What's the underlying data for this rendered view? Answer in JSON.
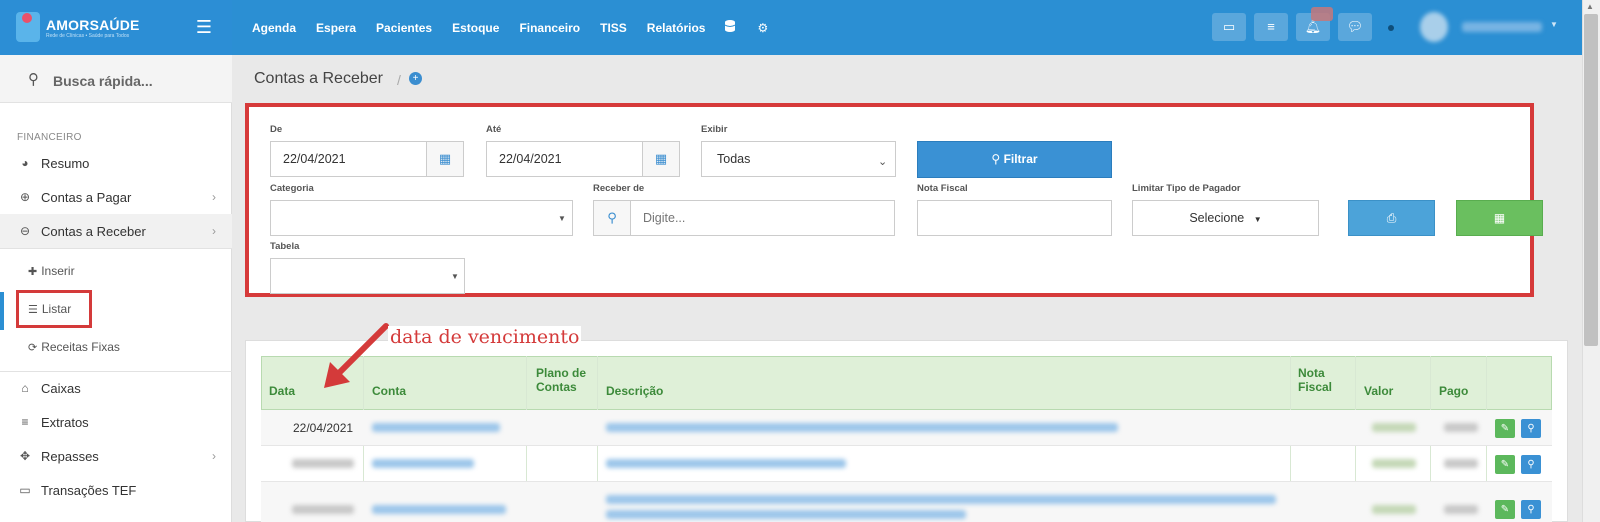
{
  "brand": {
    "name": "AMORSAÚDE",
    "tagline": "Rede de Clínicas • Saúde para Todos"
  },
  "topnav": {
    "items": [
      "Agenda",
      "Espera",
      "Pacientes",
      "Estoque",
      "Financeiro",
      "TISS",
      "Relatórios"
    ],
    "icons": [
      "database-icon",
      "gear-icon"
    ]
  },
  "top_buttons": [
    "inbox-icon",
    "list-icon",
    "bell-icon",
    "chat-icon"
  ],
  "sidebar": {
    "search_placeholder": "Busca rápida...",
    "section_label": "FINANCEIRO",
    "items": [
      {
        "label": "Resumo",
        "icon": "pie-chart-icon"
      },
      {
        "label": "Contas a Pagar",
        "icon": "arrow-up-circle-icon"
      },
      {
        "label": "Contas a Receber",
        "icon": "arrow-down-circle-icon"
      },
      {
        "label": "Caixas",
        "icon": "inbox-icon"
      },
      {
        "label": "Extratos",
        "icon": "list-icon"
      },
      {
        "label": "Repasses",
        "icon": "puzzle-icon"
      },
      {
        "label": "Transações TEF",
        "icon": "credit-card-icon"
      }
    ],
    "subitems": [
      {
        "label": "Inserir",
        "icon": "plus-icon"
      },
      {
        "label": "Listar",
        "icon": "list-icon"
      },
      {
        "label": "Receitas Fixas",
        "icon": "refresh-icon"
      }
    ]
  },
  "page": {
    "title": "Contas a Receber",
    "separator": "/"
  },
  "filters": {
    "de_label": "De",
    "de_value": "22/04/2021",
    "ate_label": "Até",
    "ate_value": "22/04/2021",
    "exibir_label": "Exibir",
    "exibir_value": "Todas",
    "filtrar_label": "Filtrar",
    "categoria_label": "Categoria",
    "receber_label": "Receber de",
    "receber_placeholder": "Digite...",
    "nota_label": "Nota Fiscal",
    "limitar_label": "Limitar Tipo de Pagador",
    "limitar_value": "Selecione",
    "tabela_label": "Tabela"
  },
  "annotation": "data de vencimento",
  "table": {
    "headers": {
      "data": "Data",
      "conta": "Conta",
      "plano": "Plano de Contas",
      "descricao": "Descrição",
      "nota": "Nota Fiscal",
      "valor": "Valor",
      "pago": "Pago"
    },
    "rows": [
      {
        "data": "22/04/2021"
      }
    ]
  },
  "colors": {
    "topbar": "#2b8fd3",
    "highlight_border": "#d63a3a",
    "table_header": "#dff0d8",
    "filter_button": "#3a91d4",
    "excel_button": "#6abf5f"
  }
}
